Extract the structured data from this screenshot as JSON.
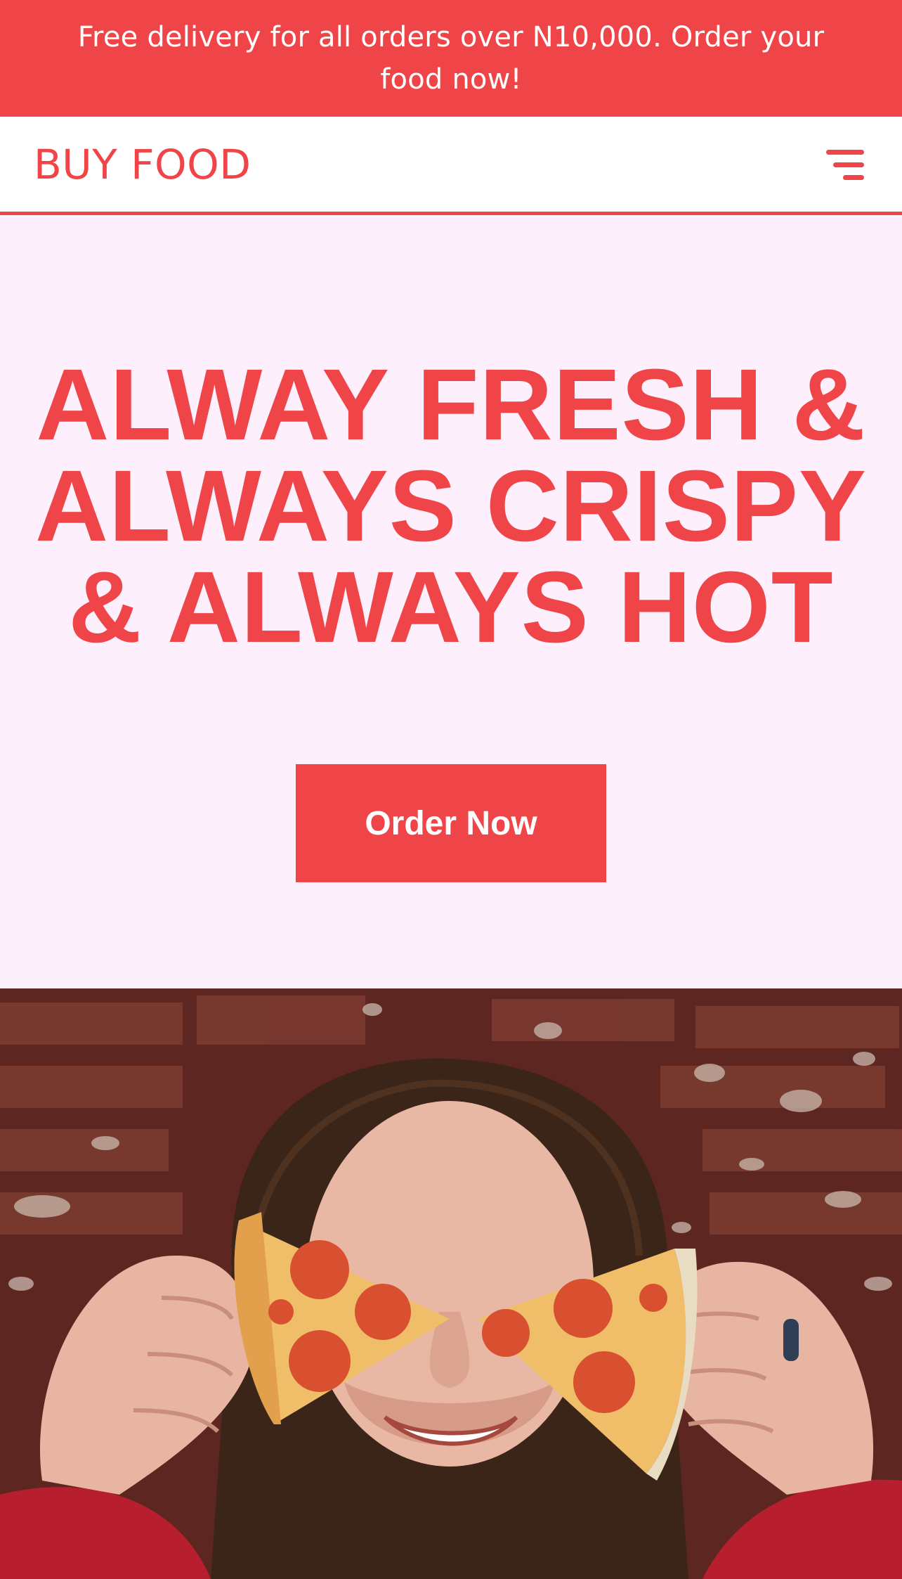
{
  "announcement": {
    "text": "Free delivery for all orders over N10,000. Order your food now!"
  },
  "navbar": {
    "brand": "BUY FOOD",
    "menu_icon": "hamburger-menu-icon"
  },
  "hero": {
    "title_lines": [
      "ALWAY FRESH &",
      "ALWAYS CRISPY",
      "& ALWAYS HOT"
    ],
    "cta_label": "Order Now"
  },
  "colors": {
    "accent": "#ef4548",
    "hero_background": "#fdeffb",
    "white": "#ffffff"
  }
}
